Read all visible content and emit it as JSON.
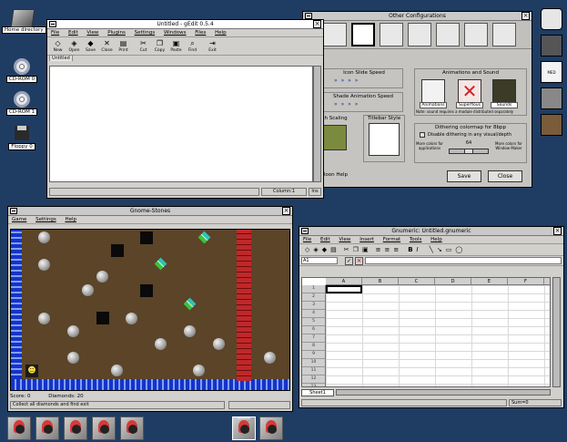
{
  "desktop": {
    "icons": [
      {
        "label": "Home directory"
      },
      {
        "label": "CD-ROM 0"
      },
      {
        "label": "CD-ROM 1"
      },
      {
        "label": "Floppy 0"
      }
    ]
  },
  "gedit": {
    "title": "Untitled - gEdit 0.5.4",
    "menu": [
      "File",
      "Edit",
      "View",
      "Plugins",
      "Settings",
      "Windows",
      "Files",
      "Help"
    ],
    "toolbar": [
      "New",
      "Open",
      "Save",
      "Close",
      "Print",
      "Cut",
      "Copy",
      "Paste",
      "Find",
      "Exit"
    ],
    "tab": "Untitled",
    "status_col": "Column:1",
    "status_ins": "Ins"
  },
  "config": {
    "title": "Other Configurations",
    "icon_slide_speed": "Icon Slide Speed",
    "shade_anim_speed": "Shade Animation Speed",
    "animations_and_sound": "Animations and Sound",
    "anim_labels": [
      "Animations",
      "Superflous",
      "Sounds"
    ],
    "sound_note": "Note: sound requires a module distributed separately",
    "dithering_title": "Dithering colormap for 8bpp",
    "disable_dithering": "Disable dithering in any visual/depth",
    "more_colors_apps": "More colors for applications",
    "more_colors_wm": "More colors for Window Maker",
    "dither_value": "64",
    "scaling": "oth Scaling",
    "titlebar_style": "Titlebar Style",
    "balloon_help": "alloon Help",
    "save_label": "Save",
    "close_label": "Close"
  },
  "stones": {
    "title": "Gnome-Stones",
    "menu": [
      "Game",
      "Settings",
      "Help"
    ],
    "score_label": "Score: 0",
    "diamonds_label": "Diamonds: 20",
    "message": "Collect all diamonds and find exit"
  },
  "gnumeric": {
    "title": "Gnumeric: Untitled.gnumeric",
    "menu": [
      "File",
      "Edit",
      "View",
      "Insert",
      "Format",
      "Tools",
      "Help"
    ],
    "cell_ref": "A1",
    "columns": [
      "A",
      "B",
      "C",
      "D",
      "E",
      "F"
    ],
    "rows": [
      "1",
      "2",
      "3",
      "4",
      "5",
      "6",
      "7",
      "8",
      "9",
      "10",
      "11",
      "12",
      "13"
    ],
    "sheet_tab": "Sheet1",
    "sum_label": "Sum=0"
  },
  "dock": {
    "mixer_label": "MED"
  },
  "taskbar": {
    "active_label": "Terminal"
  }
}
